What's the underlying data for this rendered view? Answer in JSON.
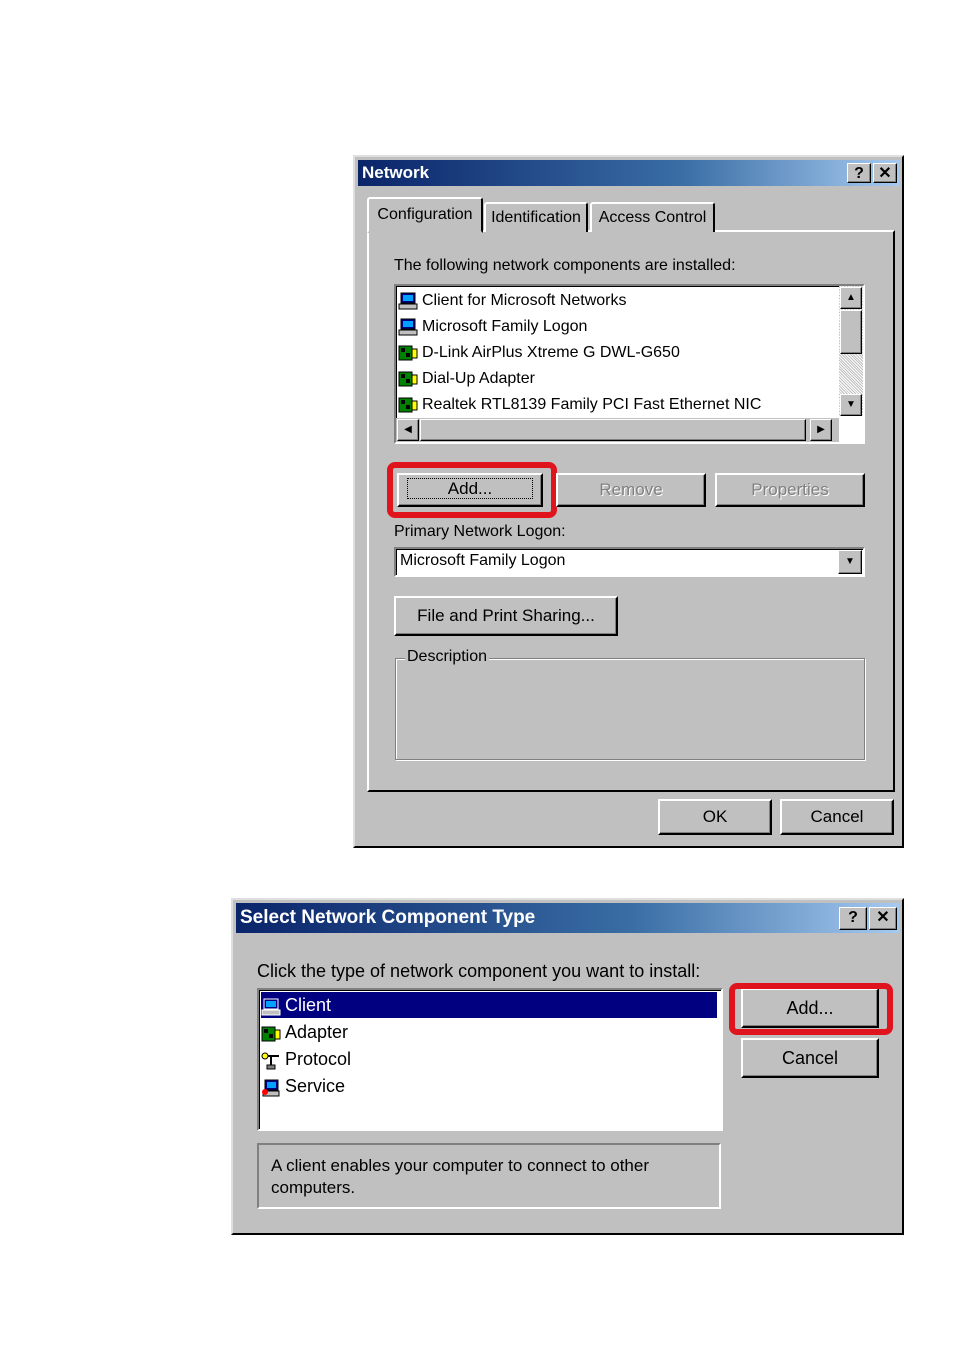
{
  "network_dialog": {
    "title": "Network",
    "help_glyph": "?",
    "close_glyph": "✕",
    "tabs": [
      {
        "label": "Configuration"
      },
      {
        "label": "Identification"
      },
      {
        "label": "Access Control"
      }
    ],
    "components_label": "The following network components are installed:",
    "components": [
      {
        "label": "Client for Microsoft Networks",
        "icon": "client-icon"
      },
      {
        "label": "Microsoft Family Logon",
        "icon": "client-icon"
      },
      {
        "label": "D-Link AirPlus Xtreme G DWL-G650",
        "icon": "adapter-icon"
      },
      {
        "label": "Dial-Up Adapter",
        "icon": "adapter-icon"
      },
      {
        "label": "Realtek RTL8139 Family PCI Fast Ethernet NIC",
        "icon": "adapter-icon"
      }
    ],
    "add_label": "Add...",
    "remove_label": "Remove",
    "properties_label": "Properties",
    "primary_logon_label": "Primary Network Logon:",
    "primary_logon_value": "Microsoft Family Logon",
    "file_print_label": "File and Print Sharing...",
    "description_label": "Description",
    "ok_label": "OK",
    "cancel_label": "Cancel",
    "highlight_color": "#e0141c"
  },
  "select_dialog": {
    "title": "Select Network Component Type",
    "help_glyph": "?",
    "close_glyph": "✕",
    "prompt": "Click the type of network component you want to install:",
    "types": [
      {
        "label": "Client",
        "icon": "client-icon",
        "selected": true
      },
      {
        "label": "Adapter",
        "icon": "adapter-icon",
        "selected": false
      },
      {
        "label": "Protocol",
        "icon": "protocol-icon",
        "selected": false
      },
      {
        "label": "Service",
        "icon": "service-icon",
        "selected": false
      }
    ],
    "add_label": "Add...",
    "cancel_label": "Cancel",
    "description": "A client enables your computer to connect to other computers."
  }
}
